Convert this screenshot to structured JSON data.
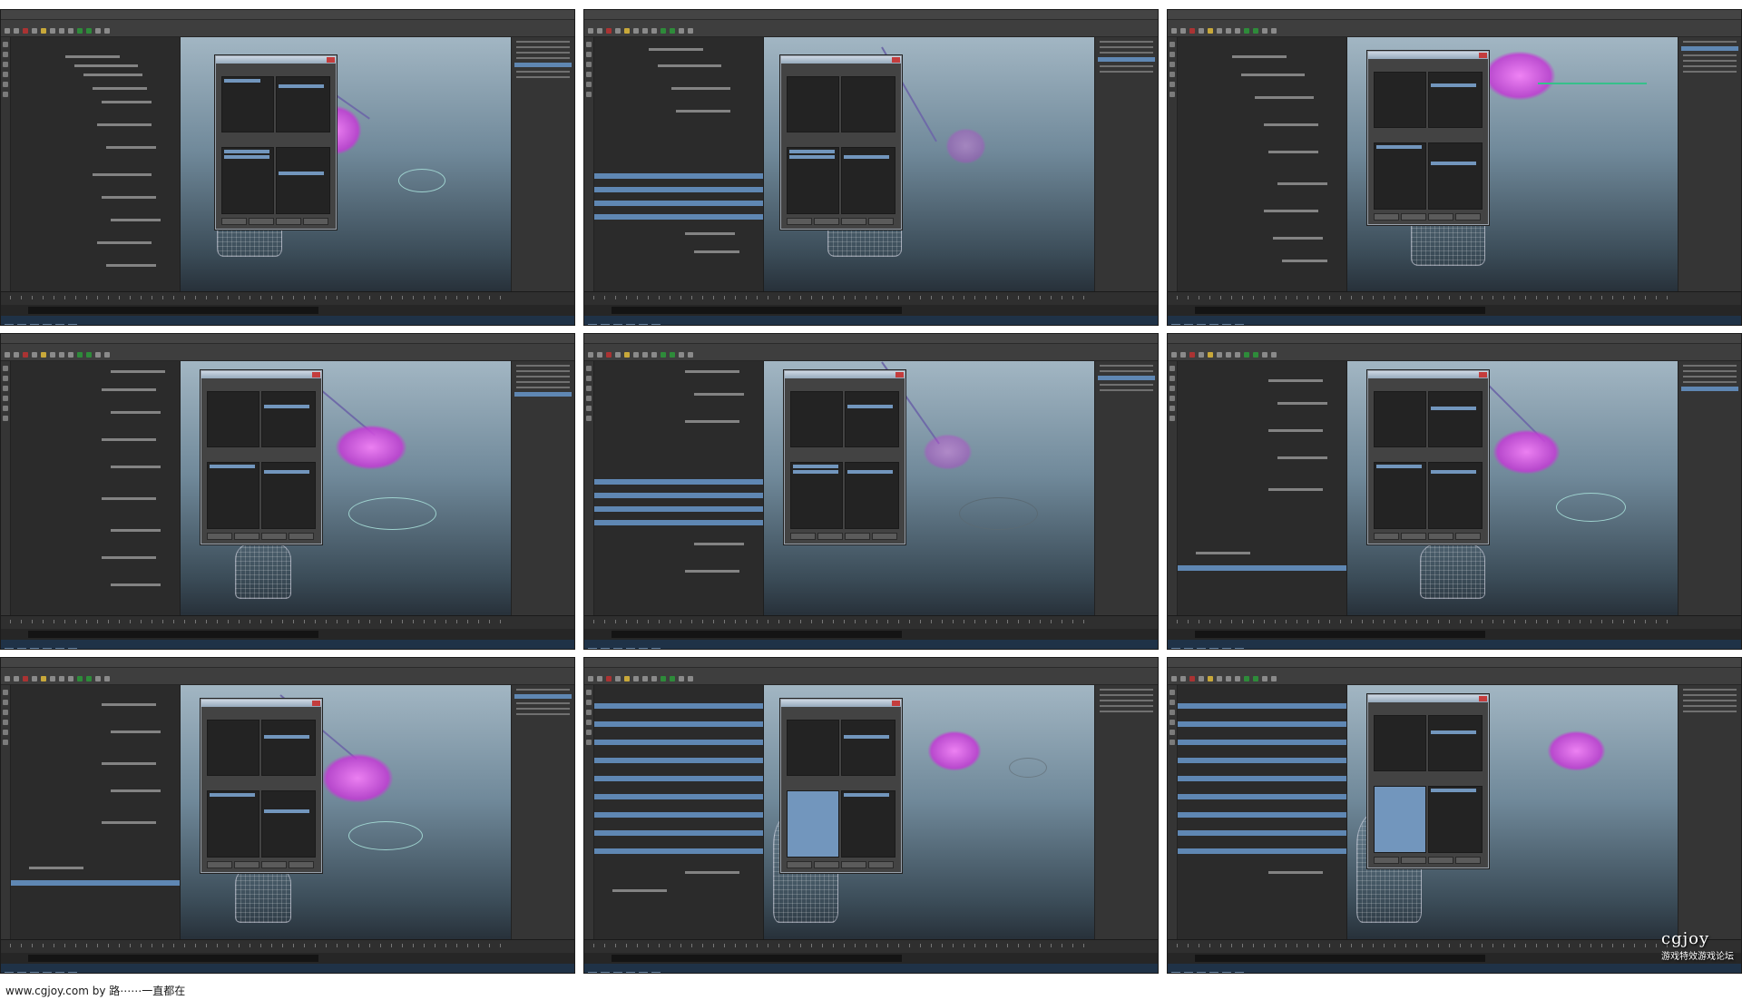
{
  "footer": {
    "credit": "www.cgjoy.com by 路⋯⋯一直都在"
  },
  "watermark": {
    "brand": "cgjoy",
    "tagline": "游戏特效游戏论坛"
  },
  "panels": [
    {
      "id": "p1"
    },
    {
      "id": "p2"
    },
    {
      "id": "p3"
    },
    {
      "id": "p4"
    },
    {
      "id": "p5"
    },
    {
      "id": "p6"
    },
    {
      "id": "p7"
    },
    {
      "id": "p8"
    },
    {
      "id": "p9"
    }
  ]
}
